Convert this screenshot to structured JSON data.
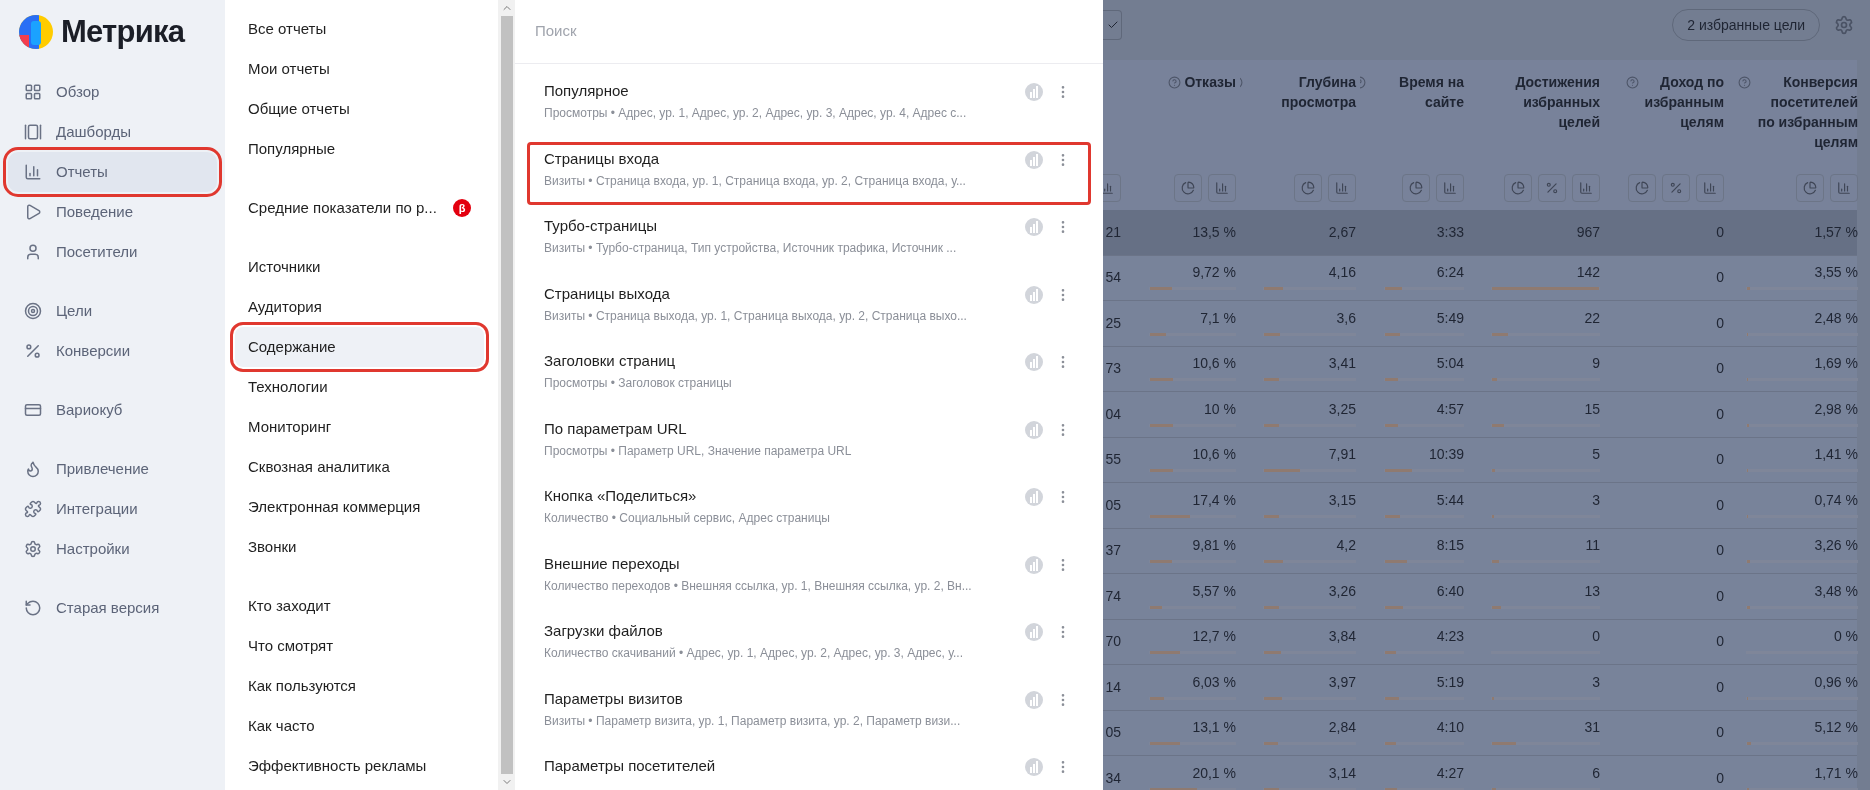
{
  "logo": {
    "text": "Метрика"
  },
  "sidebar": {
    "groups": [
      {
        "items": [
          {
            "label": "Обзор",
            "selected": false,
            "outlined": false
          },
          {
            "label": "Дашборды",
            "selected": false,
            "outlined": false
          },
          {
            "label": "Отчеты",
            "selected": true,
            "outlined": true
          },
          {
            "label": "Поведение",
            "selected": false,
            "outlined": false
          },
          {
            "label": "Посетители",
            "selected": false,
            "outlined": false
          }
        ]
      },
      {
        "items": [
          {
            "label": "Цели",
            "selected": false,
            "outlined": false
          },
          {
            "label": "Конверсии",
            "selected": false,
            "outlined": false
          }
        ]
      },
      {
        "items": [
          {
            "label": "Вариокуб",
            "selected": false,
            "outlined": false
          }
        ]
      },
      {
        "items": [
          {
            "label": "Привлечение",
            "selected": false,
            "outlined": false
          },
          {
            "label": "Интеграции",
            "selected": false,
            "outlined": false
          },
          {
            "label": "Настройки",
            "selected": false,
            "outlined": false
          }
        ]
      },
      {
        "items": [
          {
            "label": "Старая версия",
            "selected": false,
            "outlined": false
          }
        ]
      }
    ]
  },
  "menu": {
    "groups": [
      {
        "items": [
          {
            "label": "Все отчеты",
            "selected": false,
            "outlined": false
          },
          {
            "label": "Мои отчеты",
            "selected": false,
            "outlined": false
          },
          {
            "label": "Общие отчеты",
            "selected": false,
            "outlined": false
          },
          {
            "label": "Популярные",
            "selected": false,
            "outlined": false
          }
        ]
      },
      {
        "items": [
          {
            "label": "Средние показатели по р...",
            "badge": "β",
            "selected": false,
            "outlined": false
          }
        ]
      },
      {
        "items": [
          {
            "label": "Источники",
            "selected": false,
            "outlined": false
          },
          {
            "label": "Аудитория",
            "selected": false,
            "outlined": false
          },
          {
            "label": "Содержание",
            "selected": true,
            "outlined": true
          },
          {
            "label": "Технологии",
            "selected": false,
            "outlined": false
          },
          {
            "label": "Мониторинг",
            "selected": false,
            "outlined": false
          },
          {
            "label": "Сквозная аналитика",
            "selected": false,
            "outlined": false
          },
          {
            "label": "Электронная коммерция",
            "selected": false,
            "outlined": false
          },
          {
            "label": "Звонки",
            "selected": false,
            "outlined": false
          }
        ]
      },
      {
        "items": [
          {
            "label": "Кто заходит",
            "selected": false,
            "outlined": false
          },
          {
            "label": "Что смотрят",
            "selected": false,
            "outlined": false
          },
          {
            "label": "Как пользуются",
            "selected": false,
            "outlined": false
          },
          {
            "label": "Как часто",
            "selected": false,
            "outlined": false
          },
          {
            "label": "Эффективность рекламы",
            "selected": false,
            "outlined": false
          }
        ]
      }
    ]
  },
  "reports": {
    "search": {
      "placeholder": "Поиск"
    },
    "items": [
      {
        "title": "Популярное",
        "subtitle": "Просмотры • Адрес, ур. 1, Адрес, ур. 2, Адрес, ур. 3, Адрес, ур. 4, Адрес с...",
        "outlined": false
      },
      {
        "title": "Страницы входа",
        "subtitle": "Визиты • Страница входа, ур. 1, Страница входа, ур. 2, Страница входа, у...",
        "outlined": true
      },
      {
        "title": "Турбо-страницы",
        "subtitle": "Визиты • Турбо-страница, Тип устройства, Источник трафика, Источник ...",
        "outlined": false
      },
      {
        "title": "Страницы выхода",
        "subtitle": "Визиты • Страница выхода, ур. 1, Страница выхода, ур. 2, Страница выхо...",
        "outlined": false
      },
      {
        "title": "Заголовки страниц",
        "subtitle": "Просмотры • Заголовок страницы",
        "outlined": false
      },
      {
        "title": "По параметрам URL",
        "subtitle": "Просмотры • Параметр URL, Значение параметра URL",
        "outlined": false
      },
      {
        "title": "Кнопка «Поделиться»",
        "subtitle": "Количество • Социальный сервис, Адрес страницы",
        "outlined": false
      },
      {
        "title": "Внешние переходы",
        "subtitle": "Количество переходов • Внешняя ссылка, ур. 1, Внешняя ссылка, ур. 2, Вн...",
        "outlined": false
      },
      {
        "title": "Загрузки файлов",
        "subtitle": "Количество скачиваний • Адрес, ур. 1, Адрес, ур. 2, Адрес, ур. 3, Адрес, у...",
        "outlined": false
      },
      {
        "title": "Параметры визитов",
        "subtitle": "Визиты • Параметр визита, ур. 1, Параметр визита, ур. 2, Параметр визи...",
        "outlined": false
      },
      {
        "title": "Параметры посетителей",
        "outlined": false
      }
    ]
  },
  "table": {
    "goals_button": "2 избранные цели",
    "columns": [
      {
        "tools": [
          {
            "kind": "bars"
          }
        ]
      },
      {
        "label": "Отказы",
        "help": true,
        "tools": [
          {
            "kind": "pie"
          },
          {
            "kind": "bars"
          }
        ]
      },
      {
        "label": "Глубина просмотра",
        "help": true,
        "tools": [
          {
            "kind": "pie"
          },
          {
            "kind": "bars"
          }
        ]
      },
      {
        "label": "Время на сайте",
        "help": true,
        "tools": [
          {
            "kind": "pie"
          },
          {
            "kind": "bars"
          }
        ]
      },
      {
        "label": "Достижения избранных целей",
        "help": false,
        "tools": [
          {
            "kind": "pie"
          },
          {
            "kind": "percent"
          },
          {
            "kind": "bars"
          }
        ]
      },
      {
        "label": "Доход по избранным целям",
        "help": true,
        "tools": [
          {
            "kind": "pie"
          },
          {
            "kind": "percent"
          },
          {
            "kind": "bars"
          }
        ]
      },
      {
        "label": "Конверсия посетителей по избранным целям",
        "help": true,
        "tools": [
          {
            "kind": "pie"
          },
          {
            "kind": "bars"
          }
        ]
      }
    ],
    "rows": [
      {
        "highlighted": true,
        "cells": [
          {
            "text": "21"
          },
          {
            "text": "13,5 %"
          },
          {
            "text": "2,67"
          },
          {
            "text": "3:33"
          },
          {
            "text": "967"
          },
          {
            "text": "0"
          },
          {
            "text": "1,57 %"
          }
        ]
      },
      {
        "highlighted": false,
        "cells": [
          {
            "text": "54"
          },
          {
            "text": "9,72 %",
            "level": 0.26
          },
          {
            "text": "4,16",
            "level": 0.21
          },
          {
            "text": "6:24",
            "level": 0.22
          },
          {
            "text": "142",
            "level": 1
          },
          {
            "text": "0"
          },
          {
            "text": "3,55 %",
            "level": 0.03
          }
        ]
      },
      {
        "highlighted": false,
        "cells": [
          {
            "text": "25"
          },
          {
            "text": "7,1 %",
            "level": 0.19
          },
          {
            "text": "3,6",
            "level": 0.18
          },
          {
            "text": "5:49",
            "level": 0.19
          },
          {
            "text": "22",
            "level": 0.15
          },
          {
            "text": "0"
          },
          {
            "text": "2,48 %",
            "level": 0.01
          }
        ]
      },
      {
        "highlighted": false,
        "cells": [
          {
            "text": "73"
          },
          {
            "text": "10,6 %",
            "level": 0.27
          },
          {
            "text": "3,41",
            "level": 0.17
          },
          {
            "text": "5:04",
            "level": 0.17
          },
          {
            "text": "9",
            "level": 0.05
          },
          {
            "text": "0"
          },
          {
            "text": "1,69 %",
            "level": 0.01
          }
        ]
      },
      {
        "highlighted": false,
        "cells": [
          {
            "text": "04"
          },
          {
            "text": "10 %",
            "level": 0.27
          },
          {
            "text": "3,25",
            "level": 0.16
          },
          {
            "text": "4:57",
            "level": 0.17
          },
          {
            "text": "15",
            "level": 0.11
          },
          {
            "text": "0"
          },
          {
            "text": "2,98 %",
            "level": 0.02
          }
        ]
      },
      {
        "highlighted": false,
        "cells": [
          {
            "text": "55"
          },
          {
            "text": "10,6 %",
            "level": 0.27
          },
          {
            "text": "7,91",
            "level": 0.4
          },
          {
            "text": "10:39",
            "level": 0.35
          },
          {
            "text": "5",
            "level": 0.03
          },
          {
            "text": "0"
          },
          {
            "text": "1,41 %",
            "level": 0.01
          }
        ]
      },
      {
        "highlighted": false,
        "cells": [
          {
            "text": "05"
          },
          {
            "text": "17,4 %",
            "level": 0.47
          },
          {
            "text": "3,15",
            "level": 0.16
          },
          {
            "text": "5:44",
            "level": 0.19
          },
          {
            "text": "3",
            "level": 0.02
          },
          {
            "text": "0"
          },
          {
            "text": "0,74 %",
            "level": 0.01
          }
        ]
      },
      {
        "highlighted": false,
        "cells": [
          {
            "text": "37"
          },
          {
            "text": "9,81 %",
            "level": 0.26
          },
          {
            "text": "4,2",
            "level": 0.21
          },
          {
            "text": "8:15",
            "level": 0.28
          },
          {
            "text": "11",
            "level": 0.07
          },
          {
            "text": "0"
          },
          {
            "text": "3,26 %",
            "level": 0.03
          }
        ]
      },
      {
        "highlighted": false,
        "cells": [
          {
            "text": "74"
          },
          {
            "text": "5,57 %",
            "level": 0.14
          },
          {
            "text": "3,26",
            "level": 0.16
          },
          {
            "text": "6:40",
            "level": 0.23
          },
          {
            "text": "13",
            "level": 0.08
          },
          {
            "text": "0"
          },
          {
            "text": "3,48 %",
            "level": 0.03
          }
        ]
      },
      {
        "highlighted": false,
        "cells": [
          {
            "text": "70"
          },
          {
            "text": "12,7 %",
            "level": 0.35
          },
          {
            "text": "3,84",
            "level": 0.19
          },
          {
            "text": "4:23",
            "level": 0.14
          },
          {
            "text": "0"
          },
          {
            "text": "0"
          },
          {
            "text": "0 %"
          }
        ]
      },
      {
        "highlighted": false,
        "cells": [
          {
            "text": "14"
          },
          {
            "text": "6,03 %",
            "level": 0.16
          },
          {
            "text": "3,97",
            "level": 0.2
          },
          {
            "text": "5:19",
            "level": 0.18
          },
          {
            "text": "3",
            "level": 0.02
          },
          {
            "text": "0"
          },
          {
            "text": "0,96 %",
            "level": 0.01
          }
        ]
      },
      {
        "highlighted": false,
        "cells": [
          {
            "text": "05"
          },
          {
            "text": "13,1 %",
            "level": 0.35
          },
          {
            "text": "2,84",
            "level": 0.15
          },
          {
            "text": "4:10",
            "level": 0.14
          },
          {
            "text": "31",
            "level": 0.22
          },
          {
            "text": "0"
          },
          {
            "text": "5,12 %",
            "level": 0.04
          }
        ]
      },
      {
        "highlighted": false,
        "cells": [
          {
            "text": "34"
          },
          {
            "text": "20,1 %",
            "level": 0.55
          },
          {
            "text": "3,14",
            "level": 0.16
          },
          {
            "text": "4:27",
            "level": 0.15
          },
          {
            "text": "6",
            "level": 0.04
          },
          {
            "text": "0"
          },
          {
            "text": "1,71 %",
            "level": 0.02
          }
        ]
      }
    ]
  }
}
